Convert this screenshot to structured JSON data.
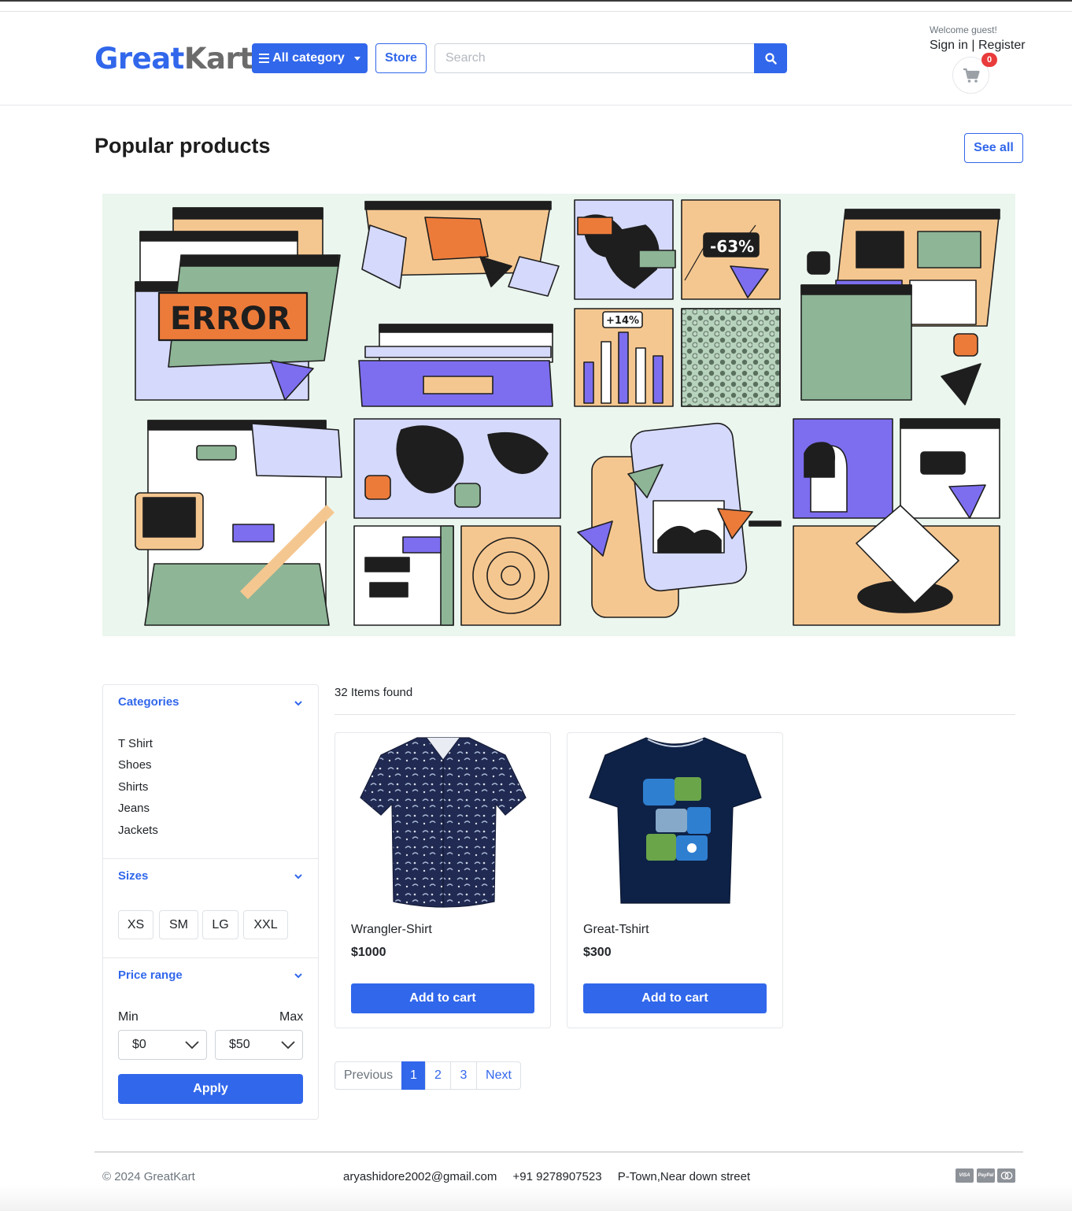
{
  "header": {
    "logo_main": "Great",
    "logo_accent": "Kart",
    "category_button": "All category",
    "store_button": "Store",
    "search_placeholder": "Search",
    "welcome": "Welcome guest!",
    "sign_in": "Sign in",
    "separator": "|",
    "register": "Register",
    "cart_count": "0"
  },
  "popular": {
    "title": "Popular products",
    "see_all": "See all",
    "banner_texts": {
      "error": "ERROR",
      "discount": "-63%",
      "increase": "+14%"
    }
  },
  "sidebar": {
    "categories_title": "Categories",
    "categories": [
      "T Shirt",
      "Shoes",
      "Shirts",
      "Jeans",
      "Jackets"
    ],
    "sizes_title": "Sizes",
    "sizes": [
      "XS",
      "SM",
      "LG",
      "XXL"
    ],
    "price_title": "Price range",
    "min_label": "Min",
    "max_label": "Max",
    "min_value": "$0",
    "max_value": "$50",
    "apply": "Apply"
  },
  "products": {
    "count_text": "32 Items found",
    "items": [
      {
        "name": "Wrangler-Shirt",
        "price": "$1000",
        "button": "Add to cart"
      },
      {
        "name": "Great-Tshirt",
        "price": "$300",
        "button": "Add to cart"
      }
    ]
  },
  "pagination": {
    "previous": "Previous",
    "pages": [
      "1",
      "2",
      "3"
    ],
    "active": "1",
    "next": "Next"
  },
  "footer": {
    "copyright": "© 2024 GreatKart",
    "email": "aryashidore2002@gmail.com",
    "phone": "+91 9278907523",
    "address": "P-Town,Near down street",
    "payments": [
      "VISA",
      "PayPal",
      "MC"
    ]
  },
  "colors": {
    "primary": "#3167eb",
    "badge": "#e93b3b",
    "banner_bg": "#ebf6ee",
    "banner_green": "#8db596",
    "banner_orange": "#ec7b3a",
    "banner_peach": "#f5c790",
    "banner_purple": "#7d6ef0",
    "banner_lavender": "#d5d9fb"
  },
  "icons": {
    "category_button": "bars-icon",
    "search_button": "search-icon",
    "cart": "cart-icon",
    "section_toggle": "chevron-down-icon",
    "select_arrow": "chevron-down-icon"
  }
}
